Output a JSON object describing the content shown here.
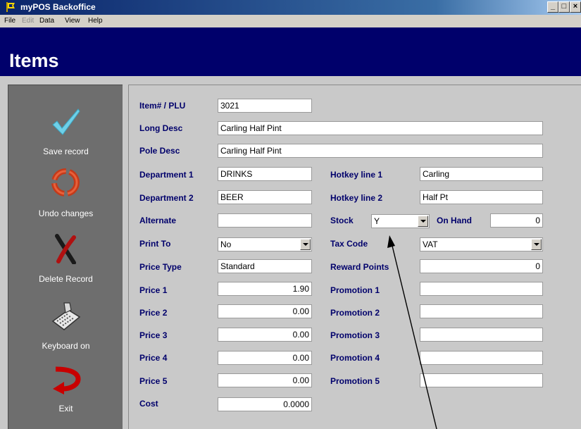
{
  "window": {
    "title": "myPOS Backoffice",
    "controls": [
      "_",
      "□",
      "×"
    ]
  },
  "menu": {
    "items": [
      {
        "label": "File",
        "enabled": true
      },
      {
        "label": "Edit",
        "enabled": false
      },
      {
        "label": "Data",
        "enabled": true
      },
      {
        "label": "View",
        "enabled": true
      },
      {
        "label": "Help",
        "enabled": true
      }
    ]
  },
  "header": {
    "title": "Items"
  },
  "sidebar": {
    "save": "Save record",
    "undo": "Undo changes",
    "delete": "Delete Record",
    "keyboard": "Keyboard on",
    "exit": "Exit"
  },
  "form": {
    "item_plu": {
      "label": "Item# / PLU",
      "value": "3021"
    },
    "long_desc": {
      "label": "Long Desc",
      "value": "Carling Half Pint"
    },
    "pole_desc": {
      "label": "Pole Desc",
      "value": "Carling Half Pint"
    },
    "department1": {
      "label": "Department 1",
      "value": "DRINKS"
    },
    "department2": {
      "label": "Department 2",
      "value": "BEER"
    },
    "alternate": {
      "label": "Alternate",
      "value": ""
    },
    "print_to": {
      "label": "Print To",
      "value": "No"
    },
    "price_type": {
      "label": "Price Type",
      "value": "Standard"
    },
    "price1": {
      "label": "Price 1",
      "value": "1.90"
    },
    "price2": {
      "label": "Price 2",
      "value": "0.00"
    },
    "price3": {
      "label": "Price 3",
      "value": "0.00"
    },
    "price4": {
      "label": "Price 4",
      "value": "0.00"
    },
    "price5": {
      "label": "Price 5",
      "value": "0.00"
    },
    "cost": {
      "label": "Cost",
      "value": "0.0000"
    },
    "hotkey1": {
      "label": "Hotkey line 1",
      "value": "Carling"
    },
    "hotkey2": {
      "label": "Hotkey line 2",
      "value": "Half Pt"
    },
    "stock": {
      "label": "Stock",
      "value": "Y"
    },
    "on_hand": {
      "label": "On Hand",
      "value": "0"
    },
    "tax_code": {
      "label": "Tax Code",
      "value": "VAT"
    },
    "reward_points": {
      "label": "Reward Points",
      "value": "0"
    },
    "promotion1": {
      "label": "Promotion 1",
      "value": ""
    },
    "promotion2": {
      "label": "Promotion 2",
      "value": ""
    },
    "promotion3": {
      "label": "Promotion 3",
      "value": ""
    },
    "promotion4": {
      "label": "Promotion 4",
      "value": ""
    },
    "promotion5": {
      "label": "Promotion 5",
      "value": ""
    }
  },
  "colors": {
    "header_bg": "#00006b",
    "label_text": "#00006b",
    "sidebar_bg": "#6e6e6e",
    "form_bg": "#c9c9c9"
  }
}
